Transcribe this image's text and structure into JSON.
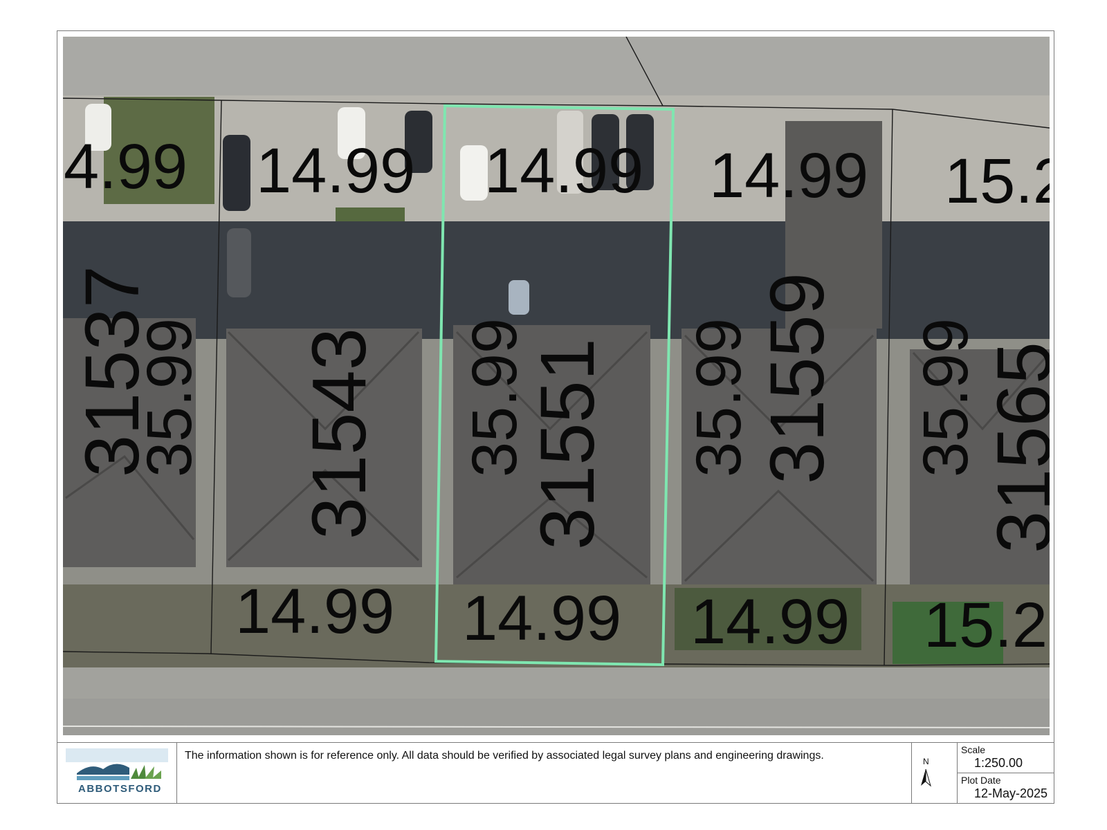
{
  "map": {
    "lot_widths": {
      "top_far_left": "4.99",
      "top_left": "14.99",
      "top_center": "14.99",
      "top_right": "14.99",
      "top_far_right": "15.2",
      "bottom_left": "14.99",
      "bottom_center": "14.99",
      "bottom_right": "14.99",
      "bottom_far_right": "15.2"
    },
    "lot_depths": {
      "far_left": "35.99",
      "center": "35.99",
      "right": "35.99",
      "far_right": "35.99"
    },
    "addresses": {
      "far_left": "31537",
      "left": "31543",
      "center": "31551",
      "right": "31559",
      "far_right": "31565"
    },
    "highlight_color": "#7fe6b0",
    "parcel_line_color": "#1a1a1a"
  },
  "footer": {
    "logo_text": "ABBOTSFORD",
    "disclaimer": "The information shown is for reference only.  All data should be verified by associated legal survey plans and engineering drawings.",
    "north_letter": "N",
    "scale_label": "Scale",
    "scale_value": "1:250.00",
    "plot_date_label": "Plot Date",
    "plot_date_value": "12-May-2025"
  }
}
